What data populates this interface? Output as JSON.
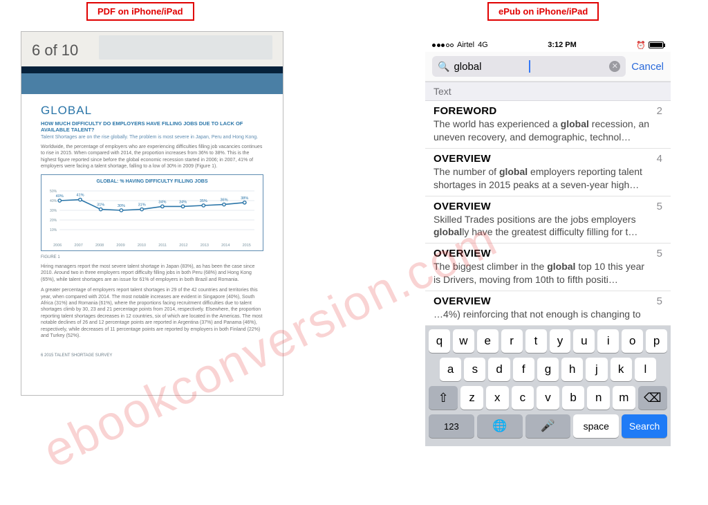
{
  "labels": {
    "left": "PDF on iPhone/iPad",
    "right": "ePub on iPhone/iPad"
  },
  "watermark": "ebookconversion.com",
  "pdf": {
    "page_counter": "6 of 10",
    "heading": "GLOBAL",
    "subheading": "HOW MUCH DIFFICULTY DO EMPLOYERS HAVE FILLING JOBS DUE TO LACK OF AVAILABLE TALENT?",
    "intro": "Talent Shortages are on the rise globally. The problem is most severe in Japan, Peru and Hong Kong.",
    "para1": "Worldwide, the percentage of employers who are experiencing difficulties filling job vacancies continues to rise in 2015. When compared with 2014, the proportion increases from 36% to 38%. This is the highest figure reported since before the global economic recession started in 2006; in 2007, 41% of employers were facing a talent shortage, falling to a low of 30% in 2009 (Figure 1).",
    "figure_label": "FIGURE 1",
    "chart_title": "GLOBAL: % HAVING DIFFICULTY FILLING JOBS",
    "para2": "Hiring managers report the most severe talent shortage in Japan (83%), as has been the case since 2010. Around two in three employers report difficulty filling jobs in both Peru (68%) and Hong Kong (65%), while talent shortages are an issue for 61% of employers in both Brazil and Romania.",
    "para3": "A greater percentage of employers report talent shortages in 29 of the 42 countries and territories this year, when compared with 2014. The most notable increases are evident in Singapore (40%), South Africa (31%) and Romania (61%), where the proportions facing recruitment difficulties due to talent shortages climb by 30, 23 and 21 percentage points from 2014, respectively. Elsewhere, the proportion reporting talent shortages decreases in 12 countries, six of which are located in the Americas. The most notable declines of 26 and 12 percentage points are reported in Argentina (37%) and Panama (46%), respectively, while decreases of 11 percentage points are reported by employers in both Finland (22%) and Turkey (52%).",
    "footer": "6    2015 TALENT SHORTAGE SURVEY"
  },
  "chart_data": {
    "type": "line",
    "title": "GLOBAL: % HAVING DIFFICULTY FILLING JOBS",
    "xlabel": "",
    "ylabel": "",
    "ylim": [
      0,
      50
    ],
    "yticks": [
      10,
      20,
      30,
      40,
      50
    ],
    "categories": [
      "2006",
      "2007",
      "2008",
      "2009",
      "2010",
      "2011",
      "2012",
      "2013",
      "2014",
      "2015"
    ],
    "values": [
      40,
      41,
      31,
      30,
      31,
      34,
      34,
      35,
      36,
      38
    ]
  },
  "epub": {
    "status": {
      "carrier": "Airtel",
      "network": "4G",
      "time": "3:12 PM"
    },
    "search": {
      "query": "global",
      "cancel": "Cancel"
    },
    "section_header": "Text",
    "results": [
      {
        "title": "FOREWORD",
        "page": "2",
        "pre": "The world has experienced a ",
        "match": "global",
        "post": " recession, an uneven recovery, and demographic, technol…"
      },
      {
        "title": "OVERVIEW",
        "page": "4",
        "pre": "The number of ",
        "match": "global",
        "post": " employers reporting talent shortages in 2015 peaks at a seven-year high…"
      },
      {
        "title": "OVERVIEW",
        "page": "5",
        "pre": "Skilled Trades positions are the jobs employers ",
        "match": "global",
        "post": "ly have the greatest difficulty filling for t…"
      },
      {
        "title": "OVERVIEW",
        "page": "5",
        "pre": "The biggest climber in the ",
        "match": "global",
        "post": " top 10 this year is Drivers, moving from 10th to fifth positi…"
      },
      {
        "title": "OVERVIEW",
        "page": "5",
        "pre": "…4%) reinforcing that not enough is changing to",
        "match": "",
        "post": ""
      }
    ],
    "keyboard": {
      "row1": [
        "q",
        "w",
        "e",
        "r",
        "t",
        "y",
        "u",
        "i",
        "o",
        "p"
      ],
      "row2": [
        "a",
        "s",
        "d",
        "f",
        "g",
        "h",
        "j",
        "k",
        "l"
      ],
      "row3": [
        "z",
        "x",
        "c",
        "v",
        "b",
        "n",
        "m"
      ],
      "shift": "⇧",
      "backspace": "⌫",
      "numbers": "123",
      "globe": "🌐",
      "mic": "🎤",
      "space": "space",
      "search": "Search"
    }
  }
}
